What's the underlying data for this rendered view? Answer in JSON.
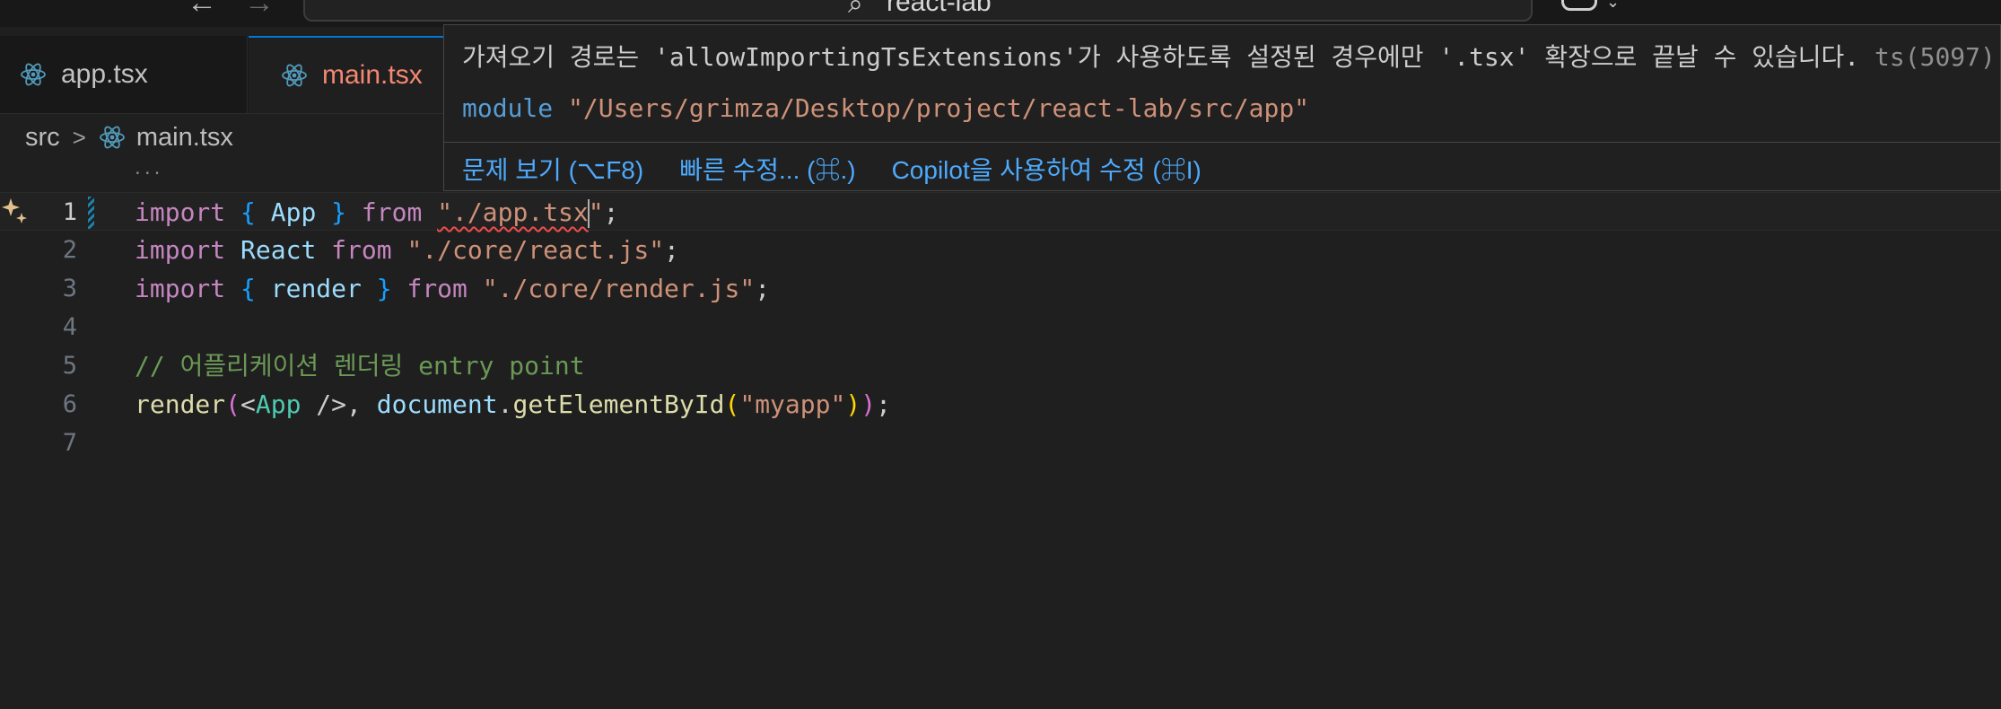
{
  "titlebar": {
    "command_center_text": "react-lab",
    "back_glyph": "←",
    "forward_glyph": "→"
  },
  "tabs": [
    {
      "label": "app.tsx",
      "icon": "react-icon",
      "active": false
    },
    {
      "label": "main.tsx",
      "icon": "react-icon",
      "active": true,
      "status_color": "#f48771"
    }
  ],
  "breadcrumb": {
    "folder": "src",
    "separator": ">",
    "file": "main.tsx",
    "ellipsis": "..."
  },
  "editor": {
    "line_numbers": [
      "1",
      "2",
      "3",
      "4",
      "5",
      "6",
      "7"
    ],
    "lines": {
      "l1": {
        "import": "import",
        "ob": "{",
        "name": "App",
        "cb": "}",
        "from": "from",
        "path": "\"./app.tsx",
        "close": "\"",
        "semi": ";"
      },
      "l2": {
        "import": "import",
        "name": "React",
        "from": "from",
        "path": "\"./core/react.js\"",
        "semi": ";"
      },
      "l3": {
        "import": "import",
        "ob": "{",
        "name": "render",
        "cb": "}",
        "from": "from",
        "path": "\"./core/render.js\"",
        "semi": ";"
      },
      "l5": {
        "comment": "// 어플리케이션 렌더링 entry point"
      },
      "l6": {
        "fn": "render",
        "op": "(",
        "lt": "<",
        "tag": "App",
        "selfclose": " />",
        "comma": ", ",
        "obj": "document",
        "dot": ".",
        "method": "getElementById",
        "op2": "(",
        "arg": "\"myapp\"",
        "cp2": ")",
        "cp": ")",
        "semi": ";"
      }
    }
  },
  "hover": {
    "message": "가져오기 경로는 'allowImportingTsExtensions'가 사용하도록 설정된 경우에만 '.tsx' 확장으로 끝날 수 있습니다.",
    "code": "ts(5097)",
    "module_keyword": "module",
    "module_path": "\"/Users/grimza/Desktop/project/react-lab/src/app\"",
    "actions": [
      "문제 보기 (⌥F8)",
      "빠른 수정... (⌘.)",
      "Copilot을 사용하여 수정 (⌘I)"
    ]
  },
  "colors": {
    "accent": "#0078d4",
    "error": "#f14c4c",
    "link": "#4daafc"
  }
}
